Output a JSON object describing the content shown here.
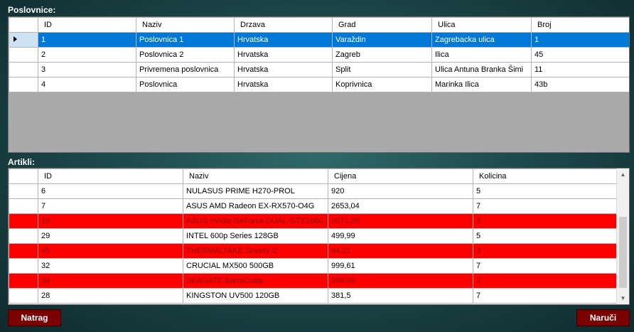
{
  "poslovnice": {
    "label": "Poslovnice:",
    "columns": [
      "ID",
      "Naziv",
      "Drzava",
      "Grad",
      "Ulica",
      "Broj"
    ],
    "rows": [
      [
        "1",
        "Poslovnica 1",
        "Hrvatska",
        "Varaždin",
        "Zagrebacka ulica",
        "1"
      ],
      [
        "2",
        "Poslovnica 2",
        "Hrvatska",
        "Zagreb",
        "Ilica",
        "45"
      ],
      [
        "3",
        "Privremena poslovnica",
        "Hrvatska",
        "Split",
        "Ulica Antuna Branka Šimi",
        "11"
      ],
      [
        "4",
        "Poslovnica",
        "Hrvatska",
        "Koprivnica",
        "Marinka Ilica",
        "43b"
      ]
    ],
    "selected_row": 0
  },
  "artikli": {
    "label": "Artikli:",
    "columns": [
      "ID",
      "Naziv",
      "Cijena",
      "Kolicina"
    ],
    "rows": [
      [
        "6",
        "NULASUS PRIME H270-PROL",
        "920",
        "5"
      ],
      [
        "7",
        "ASUS AMD Radeon EX-RX570-O4G",
        "2653,04",
        "7"
      ],
      [
        "10",
        "ASUS nVidia GeForce DUAL-GTX1060...",
        "2071,55",
        "3"
      ],
      [
        "29",
        "INTEL 600p Series 128GB",
        "499,99",
        "5"
      ],
      [
        "45",
        "THERMALTAKE Gravity i2",
        "84,01",
        "3"
      ],
      [
        "32",
        "CRUCIAL MX500 500GB",
        "999,61",
        "7"
      ],
      [
        "34",
        "SEAGATE BarraCuda",
        "399,99",
        "3"
      ],
      [
        "28",
        "KINGSTON UV500 120GB",
        "381,5",
        "7"
      ]
    ],
    "highlighted_rows": [
      2,
      4,
      6
    ],
    "highlight_color": "#ff0000"
  },
  "buttons": {
    "back": "Natrag",
    "order": "Naruči"
  },
  "colors": {
    "selection": "#0078d7",
    "button_bg": "#7a0000"
  },
  "icons": {
    "row_indicator": "triangle-right",
    "scroll_up": "chevron-up",
    "scroll_down": "chevron-down"
  }
}
